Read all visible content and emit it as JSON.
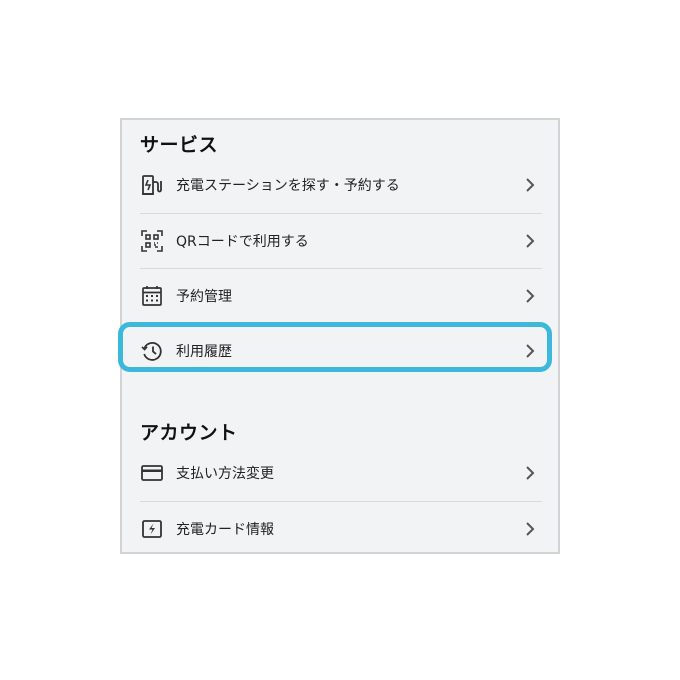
{
  "sections": [
    {
      "title": "サービス",
      "items": [
        {
          "label": "充電ステーションを探す・予約する",
          "icon": "ev-charger-icon"
        },
        {
          "label": "QRコードで利用する",
          "icon": "qr-scan-icon"
        },
        {
          "label": "予約管理",
          "icon": "calendar-icon"
        },
        {
          "label": "利用履歴",
          "icon": "history-icon",
          "highlighted": true
        }
      ]
    },
    {
      "title": "アカウント",
      "items": [
        {
          "label": "支払い方法変更",
          "icon": "credit-card-icon"
        },
        {
          "label": "充電カード情報",
          "icon": "charge-card-icon"
        }
      ]
    }
  ],
  "colors": {
    "panel_bg": "#f2f3f5",
    "highlight": "#3bb8db",
    "icon": "#333333",
    "chevron": "#555555"
  }
}
